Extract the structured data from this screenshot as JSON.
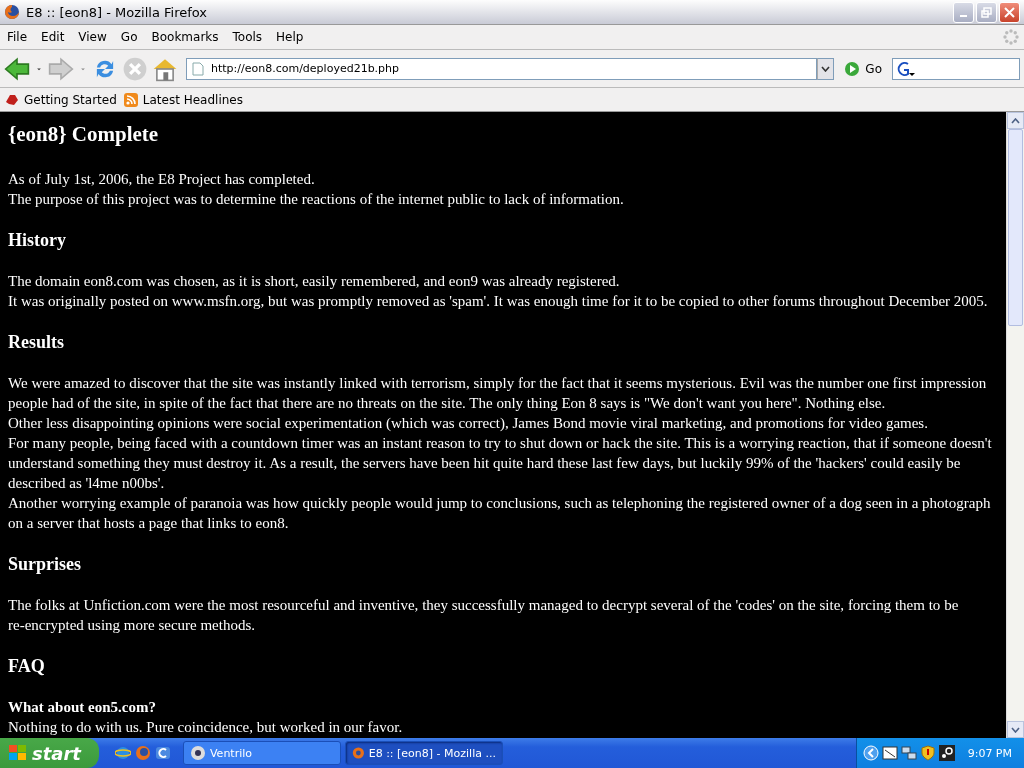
{
  "window": {
    "title": "E8 :: [eon8] - Mozilla Firefox"
  },
  "menu": [
    "File",
    "Edit",
    "View",
    "Go",
    "Bookmarks",
    "Tools",
    "Help"
  ],
  "address": {
    "value": "http://eon8.com/deployed21b.php"
  },
  "go_label": "Go",
  "bookmarks": [
    {
      "label": "Getting Started",
      "kind": "page"
    },
    {
      "label": "Latest Headlines",
      "kind": "feed"
    }
  ],
  "page": {
    "title": "{eon8} Complete",
    "blocks": [
      {
        "kind": "para",
        "lines": [
          "As of July 1st, 2006, the E8 Project has completed.",
          "The purpose of this project was to determine the reactions of the internet public to lack of information."
        ]
      },
      {
        "kind": "heading",
        "text": "History"
      },
      {
        "kind": "para",
        "lines": [
          "The domain eon8.com was chosen, as it is short, easily remembered, and eon9 was already registered.",
          "It was originally posted on www.msfn.org, but was promptly removed as 'spam'. It was enough time for it to be copied to other forums throughout December 2005."
        ]
      },
      {
        "kind": "heading",
        "text": "Results"
      },
      {
        "kind": "para",
        "lines": [
          "We were amazed to discover that the site was instantly linked with terrorism, simply for the fact that it seems mysterious. Evil was the number one first impression people had of the site, in spite of the fact that there are no threats on the site. The only thing Eon 8 says is \"We don't want you here\". Nothing else.",
          "Other less disappointing opinions were social experimentation (which was correct), James Bond movie viral marketing, and promotions for video games.",
          "For many people, being faced with a countdown timer was an instant reason to try to shut down or hack the site. This is a worrying reaction, that if someone doesn't understand something they must destroy it. As a result, the servers have been hit quite hard these last few days, but luckily 99% of the 'hackers' could easily be described as 'l4me n00bs'.",
          "Another worrying example of paranoia was how quickly people would jump to conclusions, such as telephoning the registered owner of a dog seen in a photograph on a server that hosts a page that links to eon8."
        ]
      },
      {
        "kind": "heading",
        "text": "Surprises"
      },
      {
        "kind": "para",
        "lines": [
          "The folks at Unfiction.com were the most resourceful and inventive, they successfully managed to decrypt several of the 'codes' on the site, forcing them to be re-encrypted using more secure methods."
        ]
      },
      {
        "kind": "heading",
        "text": "FAQ"
      },
      {
        "kind": "question",
        "text": "What about eon5.com?"
      },
      {
        "kind": "para",
        "lines": [
          "Nothing to do with us. Pure coincidence, but worked in our favor."
        ]
      }
    ]
  },
  "taskbar": {
    "start": "start",
    "tasks": [
      {
        "label": "Ventrilo",
        "selected": false
      },
      {
        "label": "E8 :: [eon8] - Mozilla ...",
        "selected": true
      }
    ],
    "clock": "9:07 PM"
  }
}
